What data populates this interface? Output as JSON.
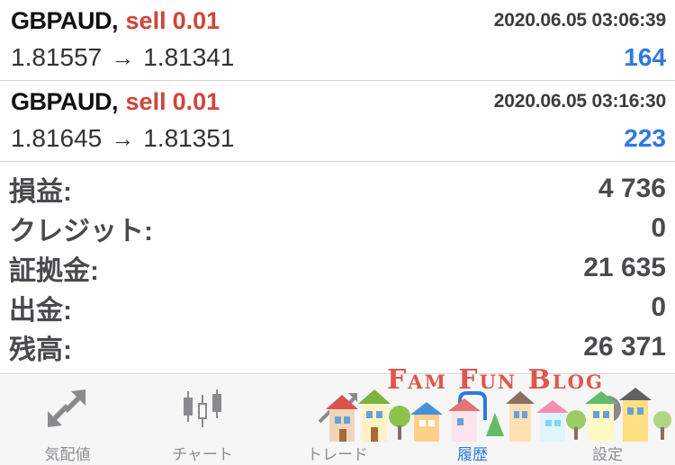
{
  "trades": [
    {
      "symbol": "GBPAUD",
      "side": "sell",
      "volume": "0.01",
      "time": "2020.06.05 03:06:39",
      "open_price": "1.81557",
      "close_price": "1.81341",
      "profit": "164"
    },
    {
      "symbol": "GBPAUD",
      "side": "sell",
      "volume": "0.01",
      "time": "2020.06.05 03:16:30",
      "open_price": "1.81645",
      "close_price": "1.81351",
      "profit": "223"
    }
  ],
  "summary": [
    {
      "label": "損益:",
      "value": "4 736"
    },
    {
      "label": "クレジット:",
      "value": "0"
    },
    {
      "label": "証拠金:",
      "value": "21 635"
    },
    {
      "label": "出金:",
      "value": "0"
    },
    {
      "label": "残高:",
      "value": "26 371"
    }
  ],
  "tabs": [
    {
      "label": "気配値",
      "icon": "quotes-arrows-icon",
      "active": false
    },
    {
      "label": "チャート",
      "icon": "candlestick-chart-icon",
      "active": false
    },
    {
      "label": "トレード",
      "icon": "trade-chart-icon",
      "active": false
    },
    {
      "label": "履歴",
      "icon": "history-icon",
      "active": true
    },
    {
      "label": "設定",
      "icon": "settings-gear-icon",
      "active": false
    }
  ],
  "watermark": {
    "text": "Fam Fun Blog"
  },
  "colors": {
    "sell": "#d0453a",
    "profit": "#2f78e0",
    "active_tab": "#2f78e0",
    "inactive_tab": "#8e8e93"
  }
}
